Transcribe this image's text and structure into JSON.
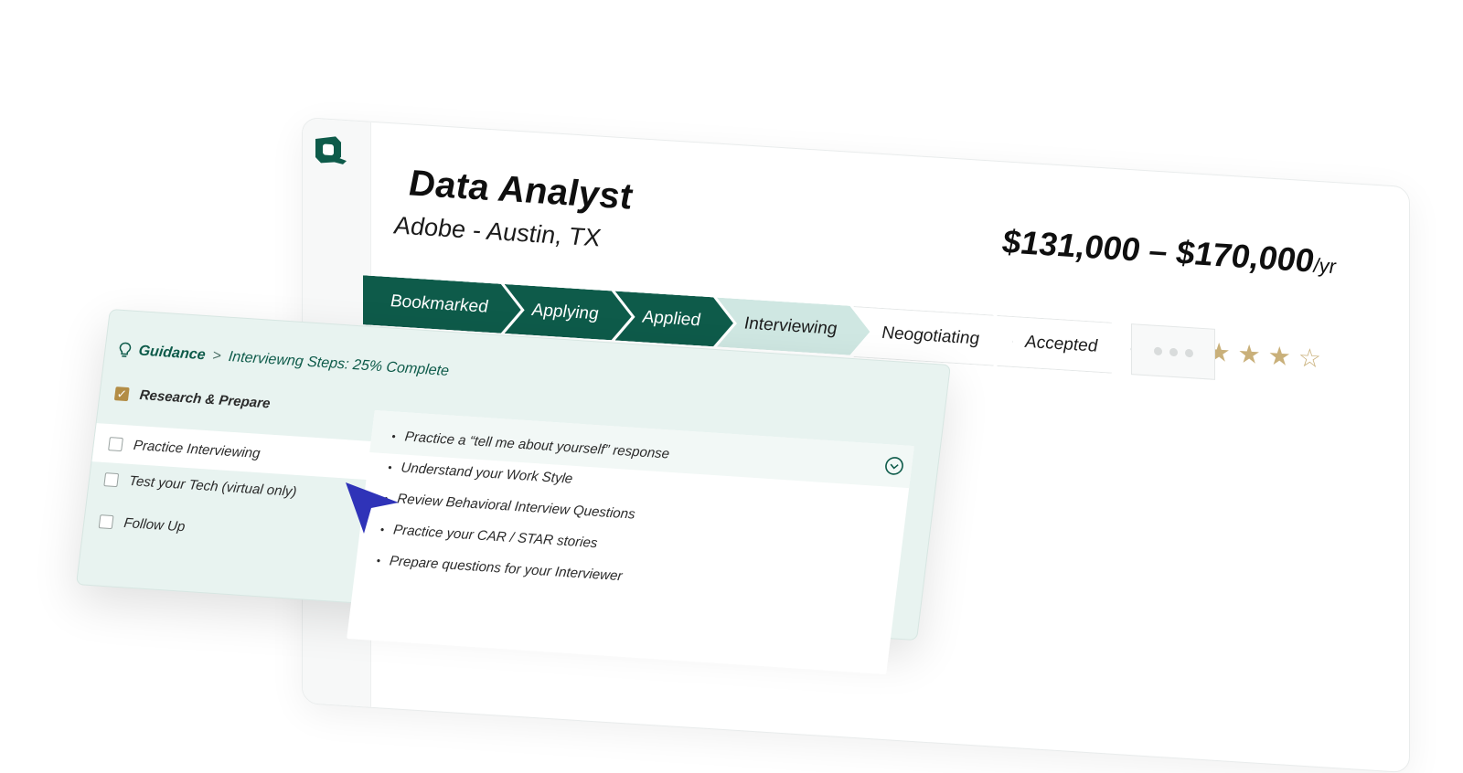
{
  "job": {
    "title": "Data Analyst",
    "company_location": "Adobe - Austin, TX",
    "salary": "$131,000 – $170,000",
    "salary_period": "/yr",
    "rating": 4,
    "rating_max": 5
  },
  "pipeline": {
    "steps": [
      {
        "label": "Bookmarked",
        "state": "done"
      },
      {
        "label": "Applying",
        "state": "done"
      },
      {
        "label": "Applied",
        "state": "done"
      },
      {
        "label": "Interviewing",
        "state": "current"
      },
      {
        "label": "Neogotiating",
        "state": "todo"
      },
      {
        "label": "Accepted",
        "state": "todo"
      }
    ]
  },
  "guidance": {
    "label": "Guidance",
    "separator": ">",
    "progress_text": "Interviewng Steps: 25% Complete",
    "tasks": [
      {
        "label": "Research & Prepare",
        "checked": true
      },
      {
        "label": "Practice Interviewing",
        "checked": false
      },
      {
        "label": "Test your Tech (virtual only)",
        "checked": false
      },
      {
        "label": "Follow Up",
        "checked": false
      }
    ],
    "details": [
      "Practice a “tell me about yourself” response",
      "Understand your Work Style",
      "Review Behavioral Interview Questions",
      "Practice your CAR / STAR stories",
      "Prepare questions for your Interviewer"
    ]
  },
  "colors": {
    "brand": "#0e5b4a",
    "current_step": "#cfe7e2",
    "star": "#c9b07a",
    "check": "#b38d46",
    "cursor": "#2f33b8",
    "guidance_bg": "#e8f3f0"
  },
  "icons": {
    "logo": "logo-icon",
    "bulb": "lightbulb-icon",
    "expand": "chevron-down-circle-icon",
    "cursor": "pointer-cursor-icon",
    "star": "star-icon"
  }
}
